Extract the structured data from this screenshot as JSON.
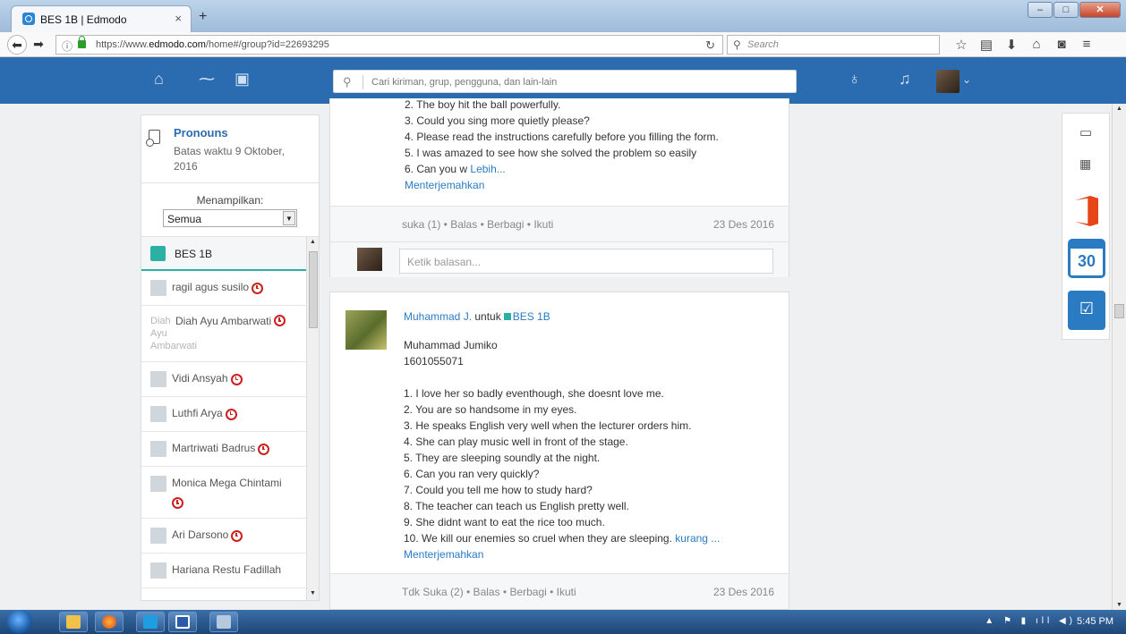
{
  "browser": {
    "tab_title": "BES 1B | Edmodo",
    "tab_close": "×",
    "new_tab": "+",
    "url_prefix": "https://www.",
    "url_domain": "edmodo.com",
    "url_path": "/home#/group?id=22693295",
    "search_placeholder": "Search"
  },
  "edmodo": {
    "search_placeholder": "Cari kiriman, grup, pengguna, dan lain-lain"
  },
  "sidebar": {
    "assignment_title": "Pronouns",
    "assignment_due": "Batas waktu 9 Oktober, 2016",
    "showing_label": "Menampilkan:",
    "showing_value": "Semua",
    "group_name": "BES 1B",
    "members": [
      {
        "name": "ragil agus susilo"
      },
      {
        "name": "Diah Ayu Ambarwati",
        "alt": "Diah Ayu Ambarwati"
      },
      {
        "name": "Vidi Ansyah"
      },
      {
        "name": "Luthfi Arya"
      },
      {
        "name": "Martriwati Badrus"
      },
      {
        "name": "Monica Mega Chintami"
      },
      {
        "name": "Ari Darsono"
      },
      {
        "name": "Hariana Restu Fadillah"
      }
    ]
  },
  "post1": {
    "lines": [
      "2. The boy hit the ball powerfully.",
      "3. Could you sing more quietly please?",
      "4. Please read the instructions carefully before you filling the form.",
      "5. I was amazed to see how she solved the problem so easily"
    ],
    "last_line": "6. Can you w",
    "more": "Lebih...",
    "translate": "Menterjemahkan",
    "actions": "suka (1) • Balas • Berbagi • Ikuti",
    "date": "23 Des 2016",
    "reply_placeholder": "Ketik balasan..."
  },
  "post2": {
    "author": "Muhammad J.",
    "to": "untuk",
    "group": "BES 1B",
    "name_line": "Muhammad Jumiko",
    "id_line": "1601055071",
    "items": [
      "1. I love her so badly eventhough, she doesnt love me.",
      "2. You are so handsome in my eyes.",
      "3. He speaks English very well when the lecturer orders him.",
      "4. She can play music well in front of the stage.",
      "5. They are sleeping soundly at the night.",
      "6. Can you ran very quickly?",
      "7. Could you tell me how to study hard?",
      "8. The teacher can teach us English pretty well.",
      "9. She didnt want to eat the rice too much."
    ],
    "last_item": "10. We kill our enemies so cruel when they are sleeping.",
    "less": "kurang ...",
    "translate": "Menterjemahkan",
    "actions": "Tdk Suka (2) • Balas • Berbagi • Ikuti",
    "date": "23 Des 2016"
  },
  "rightbar": {
    "calendar_day": "30"
  },
  "taskbar": {
    "clock": "5:45 PM"
  },
  "colors": {
    "header_blue": "#2b6bb0",
    "group_teal": "#2bb1a4",
    "link_blue": "#2b7bc3",
    "due_red": "#cc1f1f"
  }
}
